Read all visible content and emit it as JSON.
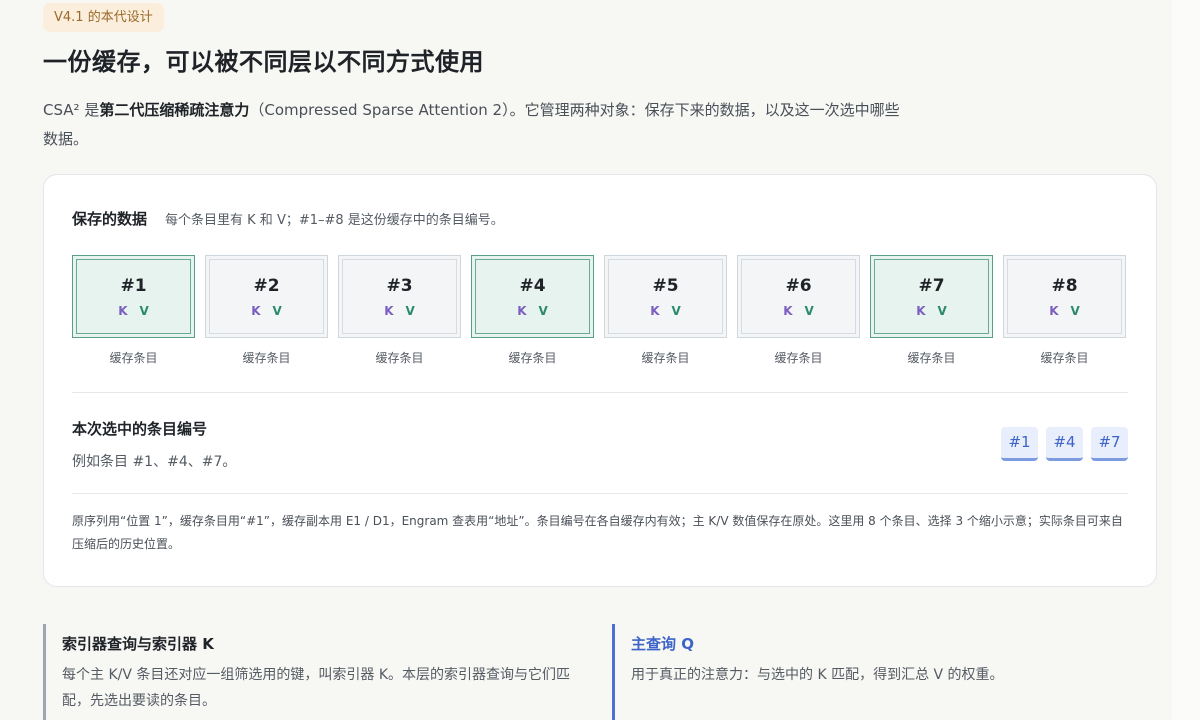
{
  "header": {
    "badge": "V4.1 的本代设计",
    "title": "一份缓存，可以被不同层以不同方式使用",
    "intro_prefix": "CSA² 是",
    "intro_bold": "第二代压缩稀疏注意力",
    "intro_suffix": "（Compressed Sparse Attention 2）。它管理两种对象：保存下来的数据，以及这一次选中哪些数据。"
  },
  "stored": {
    "title": "保存的数据",
    "desc": "每个条目里有 K 和 V；#1–#8 是这份缓存中的条目编号。",
    "entries": [
      {
        "num": "#1",
        "k": "K",
        "v": "V",
        "caption": "缓存条目",
        "selected": true
      },
      {
        "num": "#2",
        "k": "K",
        "v": "V",
        "caption": "缓存条目",
        "selected": false
      },
      {
        "num": "#3",
        "k": "K",
        "v": "V",
        "caption": "缓存条目",
        "selected": false
      },
      {
        "num": "#4",
        "k": "K",
        "v": "V",
        "caption": "缓存条目",
        "selected": true
      },
      {
        "num": "#5",
        "k": "K",
        "v": "V",
        "caption": "缓存条目",
        "selected": false
      },
      {
        "num": "#6",
        "k": "K",
        "v": "V",
        "caption": "缓存条目",
        "selected": false
      },
      {
        "num": "#7",
        "k": "K",
        "v": "V",
        "caption": "缓存条目",
        "selected": true
      },
      {
        "num": "#8",
        "k": "K",
        "v": "V",
        "caption": "缓存条目",
        "selected": false
      }
    ]
  },
  "selection": {
    "title": "本次选中的条目编号",
    "desc": "例如条目 #1、#4、#7。",
    "chips": [
      "#1",
      "#4",
      "#7"
    ]
  },
  "note": "原序列用“位置 1”，缓存条目用“#1”，缓存副本用 E1 / D1，Engram 查表用“地址”。条目编号在各自缓存内有效；主 K/V 数值保存在原处。这里用 8 个条目、选择 3 个缩小示意；实际条目可来自压缩后的历史位置。",
  "panels": {
    "indexer": {
      "title": "索引器查询与索引器 K",
      "text": "每个主 K/V 条目还对应一组筛选用的键，叫索引器 K。本层的索引器查询与它们匹配，先选出要读的条目。"
    },
    "main_query": {
      "title": "主查询 Q",
      "text": "用于真正的注意力：与选中的 K 匹配，得到汇总 V 的权重。"
    }
  },
  "colors": {
    "selected_border": "#5a9e89",
    "selected_fill": "#e7f3ee",
    "k_color": "#7a5fc0",
    "v_color": "#2b8a6e",
    "chip_fill": "#e8eefb",
    "chip_text": "#3d64c8",
    "accent_blue": "#4a6fd6",
    "badge_fill": "#fbeedd"
  }
}
